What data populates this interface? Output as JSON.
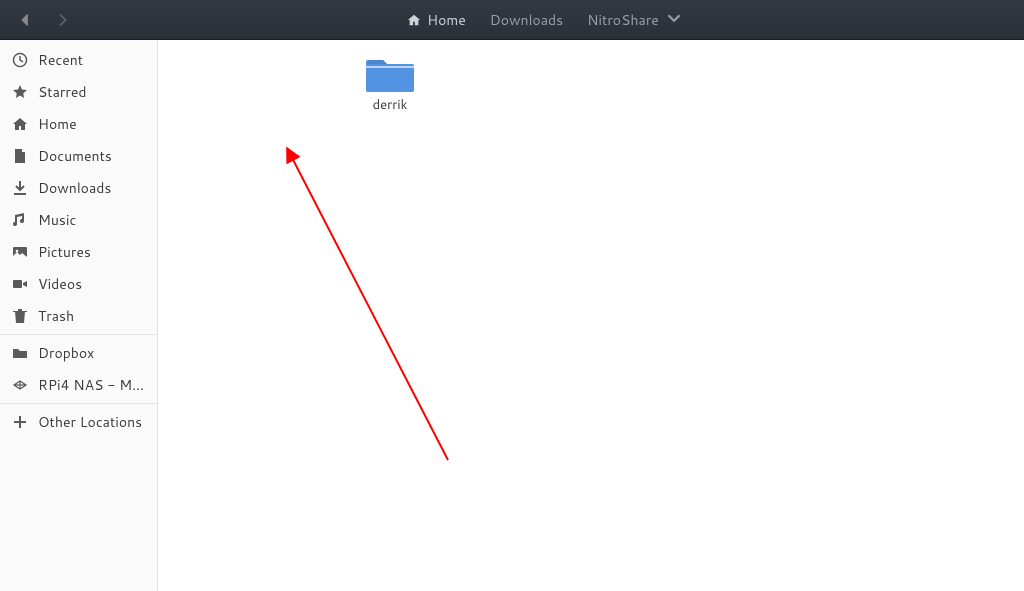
{
  "pathbar": {
    "segments": [
      {
        "label": "Home",
        "has_icon": true
      },
      {
        "label": "Downloads"
      },
      {
        "label": "NitroShare",
        "dropdown": true
      }
    ]
  },
  "sidebar": {
    "section1": [
      {
        "id": "recent",
        "label": "Recent",
        "icon": "clock"
      },
      {
        "id": "starred",
        "label": "Starred",
        "icon": "star"
      },
      {
        "id": "home",
        "label": "Home",
        "icon": "home"
      },
      {
        "id": "documents",
        "label": "Documents",
        "icon": "document"
      },
      {
        "id": "downloads",
        "label": "Downloads",
        "icon": "download"
      },
      {
        "id": "music",
        "label": "Music",
        "icon": "music"
      },
      {
        "id": "pictures",
        "label": "Pictures",
        "icon": "pictures"
      },
      {
        "id": "videos",
        "label": "Videos",
        "icon": "video"
      },
      {
        "id": "trash",
        "label": "Trash",
        "icon": "trash"
      }
    ],
    "section2": [
      {
        "id": "dropbox",
        "label": "Dropbox",
        "icon": "folder-remote"
      },
      {
        "id": "rpi4nas",
        "label": "RPi4 NAS - Me…",
        "icon": "netdrive"
      }
    ],
    "section3": [
      {
        "id": "other",
        "label": "Other Locations",
        "icon": "plus"
      }
    ]
  },
  "main": {
    "items": [
      {
        "name": "derrik",
        "type": "folder"
      }
    ]
  },
  "annotation": {
    "arrow": true
  }
}
